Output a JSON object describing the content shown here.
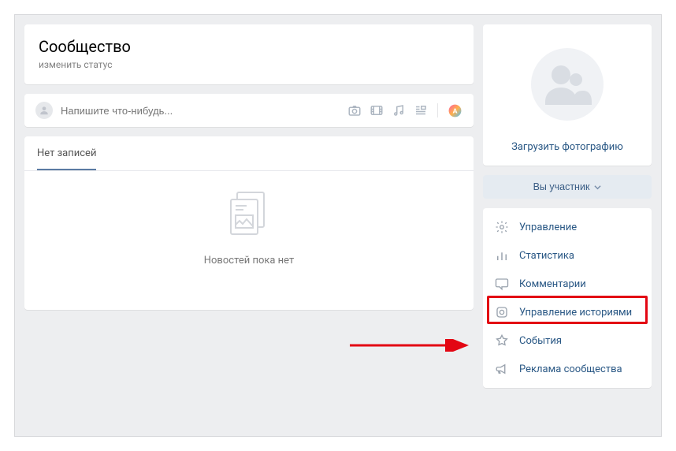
{
  "header": {
    "title": "Сообщество",
    "change_status": "изменить статус"
  },
  "composer": {
    "placeholder": "Напишите что-нибудь..."
  },
  "feed": {
    "tab_no_posts": "Нет записей",
    "empty_text": "Новостей пока нет"
  },
  "sidebar": {
    "upload_photo": "Загрузить фотографию",
    "membership_button": "Вы участник",
    "menu": [
      {
        "label": "Управление"
      },
      {
        "label": "Статистика"
      },
      {
        "label": "Комментарии"
      },
      {
        "label": "Управление историями"
      },
      {
        "label": "События"
      },
      {
        "label": "Реклама сообщества"
      }
    ]
  }
}
